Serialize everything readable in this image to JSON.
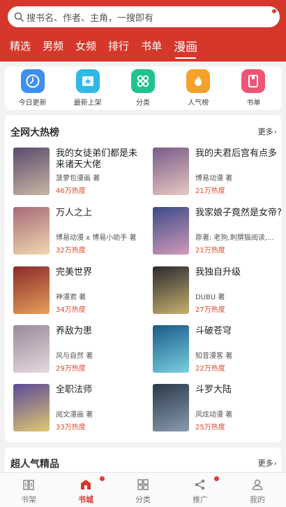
{
  "search": {
    "placeholder": "搜书名、作者、主角，一搜即有"
  },
  "tabs": [
    "精选",
    "男频",
    "女频",
    "排行",
    "书单",
    "漫画"
  ],
  "categories": [
    {
      "label": "今日更新",
      "icon": "clock-icon",
      "color": "#3f8ef2"
    },
    {
      "label": "最新上架",
      "icon": "star-box-icon",
      "color": "#31b8e6"
    },
    {
      "label": "分类",
      "icon": "grid-icon",
      "color": "#1ec48b"
    },
    {
      "label": "人气榜",
      "icon": "flame-icon",
      "color": "#f7a02c"
    },
    {
      "label": "书单",
      "icon": "book-icon",
      "color": "#f05576"
    }
  ],
  "ranking": {
    "title": "全网大热榜",
    "more": "更多",
    "books": [
      {
        "title": "我的女徒弟们都是未来诸天大佬",
        "author": "菠萝包漫画 著",
        "heat": "46万热度",
        "c1": "#5b4a6e",
        "c2": "#c7b7a3"
      },
      {
        "title": "我的夫君后宫有点多",
        "author": "博易动漫 著",
        "heat": "21万热度",
        "c1": "#7a5a8a",
        "c2": "#e6c9c0"
      },
      {
        "title": "万人之上",
        "author": "博易动漫 x 博易小助手 著",
        "heat": "32万热度",
        "c1": "#a86a78",
        "c2": "#f0d8b0"
      },
      {
        "title": "我家娘子竟然是女帝?",
        "author": "原著: 老狗,刺猬猫阅读,...",
        "heat": "21万热度",
        "c1": "#3b4a8a",
        "c2": "#d49ab8"
      },
      {
        "title": "完美世界",
        "author": "神漫君 著",
        "heat": "34万热度",
        "c1": "#8a2a2a",
        "c2": "#e6a05a"
      },
      {
        "title": "我独自升级",
        "author": "DUBU 著",
        "heat": "27万热度",
        "c1": "#2a2a2e",
        "c2": "#c8b070"
      },
      {
        "title": "养敌为患",
        "author": "风与自然 著",
        "heat": "29万热度",
        "c1": "#9a8a9a",
        "c2": "#e8d8e0"
      },
      {
        "title": "斗破苍穹",
        "author": "知音漫客 著",
        "heat": "22万热度",
        "c1": "#1a5a8a",
        "c2": "#7ad0e0"
      },
      {
        "title": "全职法师",
        "author": "阅文漫画 著",
        "heat": "33万热度",
        "c1": "#5a4a9a",
        "c2": "#e0c870"
      },
      {
        "title": "斗罗大陆",
        "author": "风炫动漫 著",
        "heat": "25万热度",
        "c1": "#2a3a4a",
        "c2": "#8a9ab0"
      }
    ]
  },
  "popular": {
    "title": "超人气精品",
    "more": "更多"
  },
  "bottom_nav": [
    {
      "label": "书架",
      "icon": "bookshelf-icon",
      "dot": false
    },
    {
      "label": "书城",
      "icon": "store-icon",
      "dot": true
    },
    {
      "label": "分类",
      "icon": "category-icon",
      "dot": false
    },
    {
      "label": "推广",
      "icon": "share-icon",
      "dot": true
    },
    {
      "label": "我的",
      "icon": "profile-icon",
      "dot": false
    }
  ],
  "colors": {
    "brand": "#d5372b",
    "heat": "#e0482b"
  }
}
